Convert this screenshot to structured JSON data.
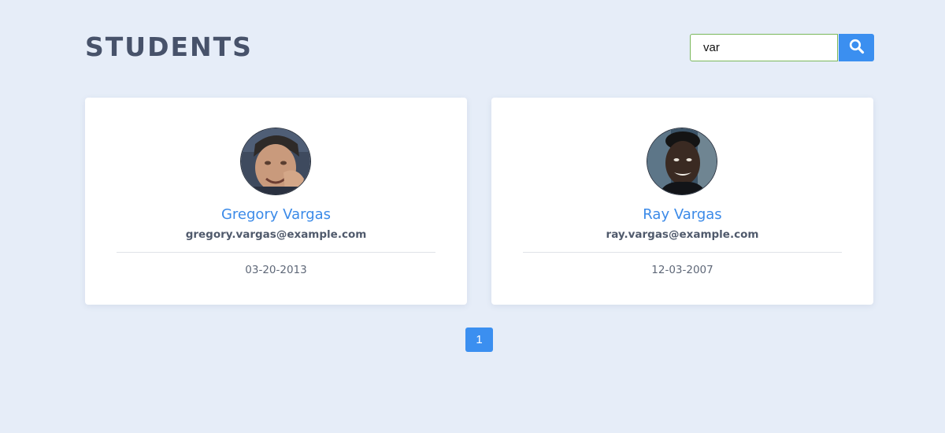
{
  "page": {
    "title": "STUDENTS",
    "background": "#e6edf8"
  },
  "search": {
    "value": "var",
    "icon": "search-icon",
    "button_color": "#3b8ff0",
    "input_border_color": "#7ab85b"
  },
  "students": [
    {
      "name": "Gregory Vargas",
      "email": "gregory.vargas@example.com",
      "date": "03-20-2013",
      "avatar": "avatar-photo"
    },
    {
      "name": "Ray Vargas",
      "email": "ray.vargas@example.com",
      "date": "12-03-2007",
      "avatar": "avatar-photo"
    }
  ],
  "pagination": {
    "current": "1",
    "active_color": "#3b8ff0"
  },
  "colors": {
    "name_link": "#3b8ae8",
    "card_bg": "#ffffff"
  }
}
